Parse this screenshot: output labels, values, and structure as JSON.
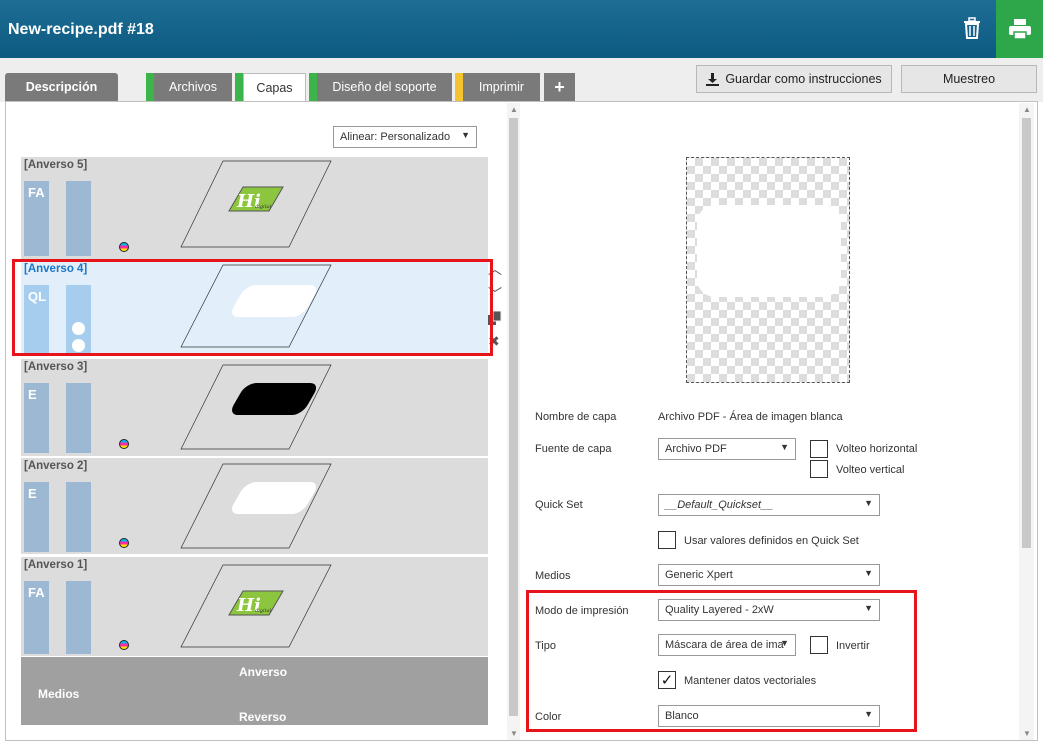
{
  "header": {
    "title": "New-recipe.pdf #18"
  },
  "tabs": [
    {
      "label": "Descripción"
    },
    {
      "label": "Archivos"
    },
    {
      "label": "Capas"
    },
    {
      "label": "Diseño del soporte"
    },
    {
      "label": "Imprimir"
    },
    {
      "label": "+"
    }
  ],
  "toolbar": {
    "save_label": "Guardar como instrucciones",
    "sample_label": "Muestreo"
  },
  "align": {
    "value": "Alinear: Personalizado"
  },
  "layers": [
    {
      "name": "[Anverso 5]",
      "code": "FA"
    },
    {
      "name": "[Anverso 4]",
      "code": "QL"
    },
    {
      "name": "[Anverso 3]",
      "code": "E"
    },
    {
      "name": "[Anverso 2]",
      "code": "E"
    },
    {
      "name": "[Anverso 1]",
      "code": "FA"
    }
  ],
  "thumb_text": {
    "hi": "Hi",
    "sig": "digital"
  },
  "medios_panel": {
    "label": "Medios",
    "front": "Anverso",
    "back": "Reverso"
  },
  "props": {
    "layer_name_label": "Nombre de capa",
    "layer_name_value": "Archivo PDF - Área de imagen blanca",
    "source_label": "Fuente de capa",
    "source_value": "Archivo PDF",
    "flip_h": "Volteo horizontal",
    "flip_v": "Volteo vertical",
    "quickset_label": "Quick Set",
    "quickset_value": "__Default_Quickset__",
    "use_quickset": "Usar valores definidos en Quick Set",
    "media_label": "Medios",
    "media_value": "Generic Xpert",
    "mode_label": "Modo de impresión",
    "mode_value": "Quality Layered - 2xW",
    "type_label": "Tipo",
    "type_value": "Máscara de área de ima",
    "invert": "Invertir",
    "keep_vector": "Mantener datos vectoriales",
    "color_label": "Color",
    "color_value": "Blanco"
  },
  "colors": {
    "header": "#0d5a80",
    "print": "#2ea64a",
    "highlight": "#e8141b",
    "selected_name": "#1a77c9"
  }
}
